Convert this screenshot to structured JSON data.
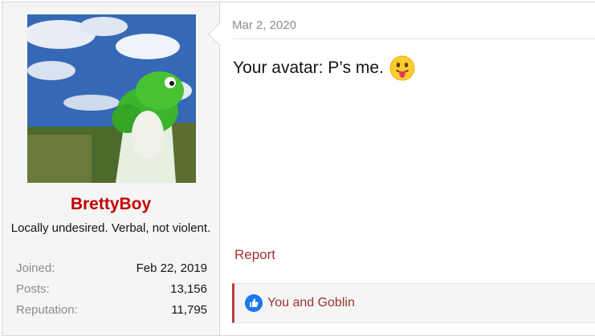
{
  "post": {
    "date": "Mar 2, 2020",
    "message": "Your avatar: P’s me.",
    "emoji_icon": "tongue-face-icon",
    "report_label": "Report",
    "reactions": {
      "icon": "thumbs-up-icon",
      "text": "You and Goblin"
    }
  },
  "user": {
    "username": "BrettyBoy",
    "title": "Locally undesired. Verbal, not violent.",
    "username_color": "#c30000",
    "stats": [
      {
        "label": "Joined:",
        "value": "Feb 22, 2019"
      },
      {
        "label": "Posts:",
        "value": "13,156"
      },
      {
        "label": "Reputation:",
        "value": "11,795"
      }
    ]
  },
  "colors": {
    "link": "#a23333",
    "muted": "#8c8c8c",
    "sidebar_bg": "#f5f5f5",
    "reaction_border": "#c33a3a"
  }
}
